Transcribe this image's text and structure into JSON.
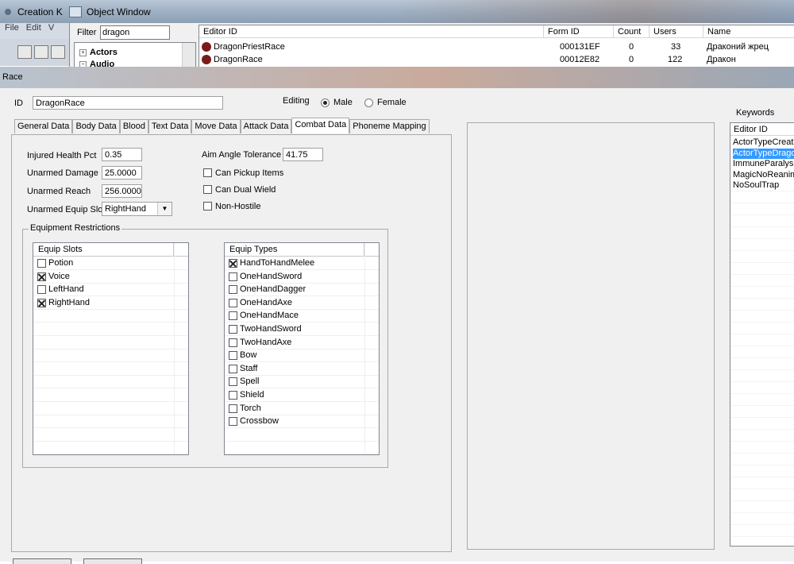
{
  "creation_kit": {
    "title": "Creation K",
    "menu": [
      "File",
      "Edit",
      "V"
    ]
  },
  "object_window": {
    "title": "Object Window",
    "filter_label": "Filter",
    "filter_value": "dragon",
    "tree": [
      {
        "label": "Actors",
        "expander": "+"
      },
      {
        "label": "Audio",
        "expander": "−"
      }
    ],
    "columns": [
      "Editor ID",
      "Form ID",
      "Count",
      "Users",
      "Name"
    ],
    "rows": [
      {
        "editor_id": "DragonPriestRace",
        "form_id": "000131EF",
        "count": "0",
        "users": "33",
        "name": "Драконий жрец"
      },
      {
        "editor_id": "DragonRace",
        "form_id": "00012E82",
        "count": "0",
        "users": "122",
        "name": "Дракон"
      }
    ]
  },
  "race_window": {
    "title": "Race",
    "id_label": "ID",
    "id_value": "DragonRace",
    "editing_label": "Editing",
    "male_label": "Male",
    "female_label": "Female",
    "selected_gender": "Male",
    "tabs": [
      "General Data",
      "Body Data",
      "Blood",
      "Text Data",
      "Move Data",
      "Attack Data",
      "Combat Data",
      "Phoneme Mapping"
    ],
    "active_tab": "Combat Data",
    "combat": {
      "injured_health_pct_label": "Injured Health Pct",
      "injured_health_pct": "0.35",
      "unarmed_damage_label": "Unarmed Damage",
      "unarmed_damage": "25.0000",
      "unarmed_reach_label": "Unarmed Reach",
      "unarmed_reach": "256.0000",
      "unarmed_equip_slot_label": "Unarmed Equip Slot",
      "unarmed_equip_slot": "RightHand",
      "aim_angle_tolerance_label": "Aim Angle Tolerance",
      "aim_angle_tolerance": "41.75",
      "can_pickup_items_label": "Can Pickup Items",
      "can_pickup_items": false,
      "can_dual_wield_label": "Can Dual Wield",
      "can_dual_wield": false,
      "non_hostile_label": "Non-Hostile",
      "non_hostile": false
    },
    "equipment_restrictions": {
      "title": "Equipment Restrictions",
      "slots_header": "Equip Slots",
      "slots": [
        {
          "label": "Potion",
          "checked": false
        },
        {
          "label": "Voice",
          "checked": true
        },
        {
          "label": "LeftHand",
          "checked": false
        },
        {
          "label": "RightHand",
          "checked": true
        }
      ],
      "types_header": "Equip Types",
      "types": [
        {
          "label": "HandToHandMelee",
          "checked": true
        },
        {
          "label": "OneHandSword",
          "checked": false
        },
        {
          "label": "OneHandDagger",
          "checked": false
        },
        {
          "label": "OneHandAxe",
          "checked": false
        },
        {
          "label": "OneHandMace",
          "checked": false
        },
        {
          "label": "TwoHandSword",
          "checked": false
        },
        {
          "label": "TwoHandAxe",
          "checked": false
        },
        {
          "label": "Bow",
          "checked": false
        },
        {
          "label": "Staff",
          "checked": false
        },
        {
          "label": "Spell",
          "checked": false
        },
        {
          "label": "Shield",
          "checked": false
        },
        {
          "label": "Torch",
          "checked": false
        },
        {
          "label": "Crossbow",
          "checked": false
        }
      ]
    },
    "keywords": {
      "label": "Keywords",
      "header": "Editor ID",
      "items": [
        "ActorTypeCreatu",
        "ActorTypeDrago",
        "ImmuneParalysis",
        "MagicNoReanim",
        "NoSoulTrap"
      ],
      "selected_index": 1
    }
  },
  "colors": {
    "selection": "#3399ff",
    "dialog_bg": "#f0f0f0"
  }
}
